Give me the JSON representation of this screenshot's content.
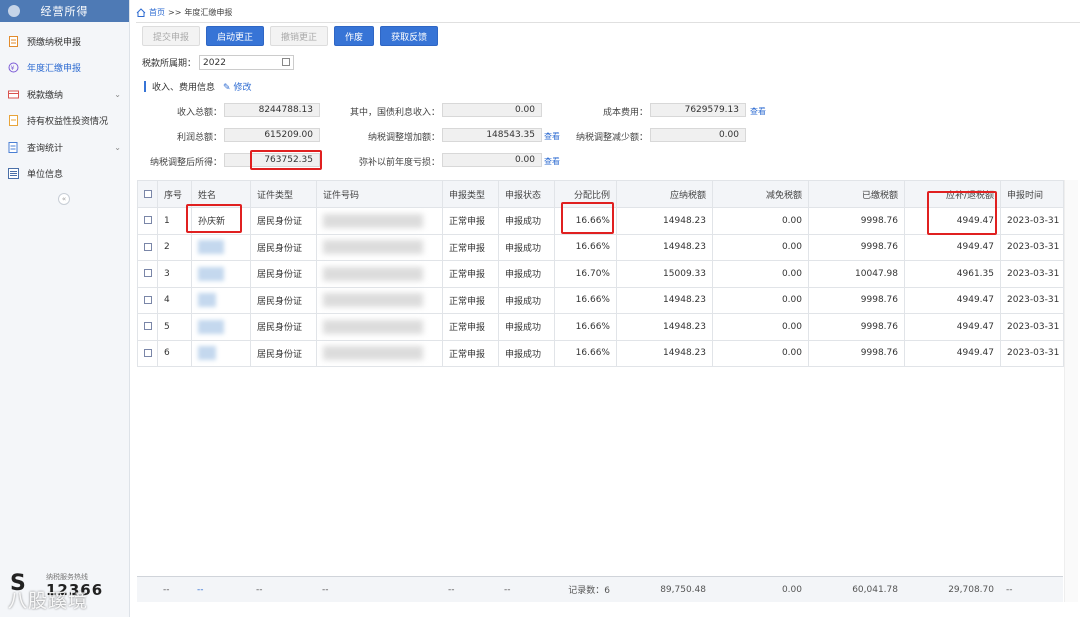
{
  "sidebar": {
    "title": "经营所得",
    "items": [
      {
        "label": "预缴纳税申报",
        "icon": "document-icon"
      },
      {
        "label": "年度汇缴申报",
        "icon": "annual-icon"
      },
      {
        "label": "税款缴纳",
        "icon": "payment-icon"
      },
      {
        "label": "持有权益性投资情况",
        "icon": "investment-icon"
      },
      {
        "label": "查询统计",
        "icon": "query-icon"
      },
      {
        "label": "单位信息",
        "icon": "info-icon"
      }
    ],
    "hotline_label": "纳税服务热线",
    "hotline_number": "12366",
    "watermark": "八股蹊境"
  },
  "breadcrumb": {
    "home": "首页",
    "sep": ">>",
    "current": "年度汇缴申报"
  },
  "toolbar": {
    "submit": "提交申报",
    "start_correction": "启动更正",
    "cancel_correction": "撤销更正",
    "void": "作废",
    "get_feedback": "获取反馈"
  },
  "period": {
    "label": "税款所属期：",
    "value": "2022"
  },
  "section": {
    "title": "收入、费用信息",
    "edit": "修改"
  },
  "fields": {
    "income_total": {
      "label": "收入总额：",
      "value": "8244788.13"
    },
    "bond_interest": {
      "label": "其中，国债利息收入：",
      "value": "0.00"
    },
    "cost": {
      "label": "成本费用：",
      "value": "7629579.13"
    },
    "profit_total": {
      "label": "利润总额：",
      "value": "615209.00"
    },
    "adj_increase": {
      "label": "纳税调整增加额：",
      "value": "148543.35"
    },
    "adj_decrease": {
      "label": "纳税调整减少额：",
      "value": "0.00"
    },
    "adj_income": {
      "label": "纳税调整后所得：",
      "value": "763752.35"
    },
    "loss_offset": {
      "label": "弥补以前年度亏损：",
      "value": "0.00"
    }
  },
  "view_link": "查看",
  "table": {
    "headers": [
      "",
      "序号",
      "姓名",
      "证件类型",
      "证件号码",
      "申报类型",
      "申报状态",
      "分配比例",
      "应纳税额",
      "减免税额",
      "已缴税额",
      "应补/退税额",
      "申报时间"
    ],
    "rows": [
      {
        "no": "1",
        "name": "孙庆新",
        "id_type": "居民身份证",
        "decl_type": "正常申报",
        "status": "申报成功",
        "ratio": "16.66%",
        "tax_due": "14948.23",
        "relief": "0.00",
        "paid": "9998.76",
        "refund": "4949.47",
        "date": "2023-03-31"
      },
      {
        "no": "2",
        "name": "",
        "id_type": "居民身份证",
        "decl_type": "正常申报",
        "status": "申报成功",
        "ratio": "16.66%",
        "tax_due": "14948.23",
        "relief": "0.00",
        "paid": "9998.76",
        "refund": "4949.47",
        "date": "2023-03-31"
      },
      {
        "no": "3",
        "name": "",
        "id_type": "居民身份证",
        "decl_type": "正常申报",
        "status": "申报成功",
        "ratio": "16.70%",
        "tax_due": "15009.33",
        "relief": "0.00",
        "paid": "10047.98",
        "refund": "4961.35",
        "date": "2023-03-31"
      },
      {
        "no": "4",
        "name": "",
        "id_type": "居民身份证",
        "decl_type": "正常申报",
        "status": "申报成功",
        "ratio": "16.66%",
        "tax_due": "14948.23",
        "relief": "0.00",
        "paid": "9998.76",
        "refund": "4949.47",
        "date": "2023-03-31"
      },
      {
        "no": "5",
        "name": "",
        "id_type": "居民身份证",
        "decl_type": "正常申报",
        "status": "申报成功",
        "ratio": "16.66%",
        "tax_due": "14948.23",
        "relief": "0.00",
        "paid": "9998.76",
        "refund": "4949.47",
        "date": "2023-03-31"
      },
      {
        "no": "6",
        "name": "",
        "id_type": "居民身份证",
        "decl_type": "正常申报",
        "status": "申报成功",
        "ratio": "16.66%",
        "tax_due": "14948.23",
        "relief": "0.00",
        "paid": "9998.76",
        "refund": "4949.47",
        "date": "2023-03-31"
      }
    ],
    "totals": {
      "dash": "--",
      "record_count": "记录数：6",
      "tax_due": "89,750.48",
      "relief": "0.00",
      "paid": "60,041.78",
      "refund": "29,708.70"
    }
  }
}
